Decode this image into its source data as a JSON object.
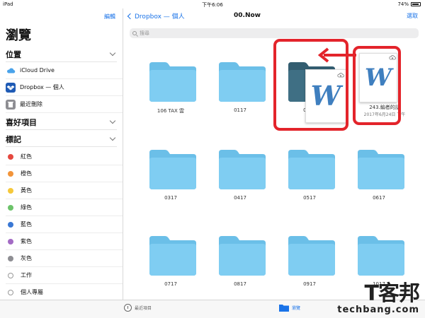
{
  "status": {
    "device": "iPad",
    "time": "下午6:06",
    "battery": "74%"
  },
  "sidebar": {
    "edit_label": "編輯",
    "title": "瀏覽",
    "locations_header": "位置",
    "locations": [
      {
        "label": "iCloud Drive",
        "icon": "icloud-icon"
      },
      {
        "label": "Dropbox — 個人",
        "icon": "dropbox-icon"
      },
      {
        "label": "最近刪除",
        "icon": "trash-icon"
      }
    ],
    "favorites_header": "喜好項目",
    "tags_header": "標記",
    "tags": [
      {
        "label": "紅色",
        "color": "#e5483f"
      },
      {
        "label": "橙色",
        "color": "#f2943a"
      },
      {
        "label": "黃色",
        "color": "#f5c83a"
      },
      {
        "label": "綠色",
        "color": "#6cc36a"
      },
      {
        "label": "藍色",
        "color": "#3a78d4"
      },
      {
        "label": "紫色",
        "color": "#a36bc4"
      },
      {
        "label": "灰色",
        "color": "#8e8e93"
      },
      {
        "label": "工作",
        "color": ""
      },
      {
        "label": "個人專屬",
        "color": ""
      }
    ]
  },
  "main": {
    "back_label": "Dropbox — 個人",
    "title": "00.Now",
    "select_label": "選取",
    "search_placeholder": "搜尋",
    "folders": [
      {
        "label": "106 TAX 雲"
      },
      {
        "label": "0117"
      },
      {
        "label": "0217"
      },
      {
        "label": "0317"
      },
      {
        "label": "0417"
      },
      {
        "label": "0517"
      },
      {
        "label": "0617"
      },
      {
        "label": "0717"
      },
      {
        "label": "0817"
      },
      {
        "label": "0917"
      },
      {
        "label": "1017"
      }
    ],
    "document": {
      "label": "243.編者的話",
      "date": "2017年6月24日 下午"
    },
    "word_letter": "W"
  },
  "tabbar": {
    "recents_label": "最近項目",
    "browse_label": "瀏覽"
  },
  "watermark": {
    "chinese": "T客邦",
    "english": "techbang.com"
  },
  "colors": {
    "accent": "#1a73e8",
    "folder": "#7fcdf2",
    "highlight": "#e3242b"
  }
}
